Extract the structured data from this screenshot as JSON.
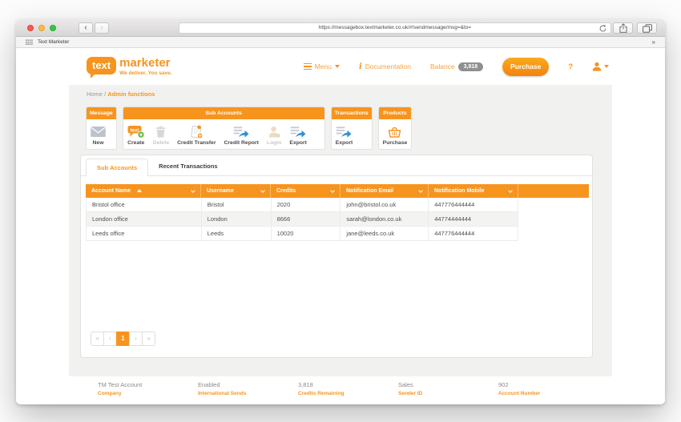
{
  "browser": {
    "url": "https://messagebox.textmarketer.co.uk/#!sendmessage/msg=&to=",
    "nav": {
      "back": "‹",
      "forward": "›"
    },
    "bookmarks": {
      "label": "Text Marketer",
      "overflow": "»"
    }
  },
  "header": {
    "logo": {
      "bubble_text": "text",
      "name": "marketer",
      "tagline": "We deliver. You save."
    },
    "nav": {
      "menu_label": "Menu",
      "documentation_label": "Documentation",
      "balance_label": "Balance",
      "balance_value": "3,818",
      "purchase_label": "Purchase",
      "help_label": "?"
    }
  },
  "breadcrumb": {
    "home": "Home",
    "separator": "/",
    "current": "Admin functions"
  },
  "toolbar": {
    "groups": [
      {
        "title": "Message",
        "items": [
          {
            "label": "New",
            "icon": "envelope-icon",
            "disabled": false
          }
        ]
      },
      {
        "title": "Sub Accounts",
        "items": [
          {
            "label": "Create",
            "icon": "speech-bubble-plus-icon",
            "disabled": false
          },
          {
            "label": "Delete",
            "icon": "trash-icon",
            "disabled": true
          },
          {
            "label": "Credit Transfer",
            "icon": "document-transfer-icon",
            "disabled": false
          },
          {
            "label": "Credit Report",
            "icon": "document-export-icon",
            "disabled": false
          },
          {
            "label": "Login",
            "icon": "person-icon",
            "disabled": true
          },
          {
            "label": "Export",
            "icon": "document-export-icon",
            "disabled": false
          }
        ]
      },
      {
        "title": "Transactions",
        "items": [
          {
            "label": "Export",
            "icon": "document-export-icon",
            "disabled": false
          }
        ]
      },
      {
        "title": "Products",
        "items": [
          {
            "label": "Purchase",
            "icon": "basket-icon",
            "disabled": false
          }
        ]
      }
    ]
  },
  "tabs": [
    {
      "label": "Sub Accounts",
      "active": true
    },
    {
      "label": "Recent Transactions",
      "active": false
    }
  ],
  "table": {
    "columns": [
      {
        "label": "Account Name",
        "sorted": "asc"
      },
      {
        "label": "Username"
      },
      {
        "label": "Credits"
      },
      {
        "label": "Notification Email"
      },
      {
        "label": "Notification Mobile"
      }
    ],
    "rows": [
      [
        "Bristol office",
        "Bristol",
        "2020",
        "john@bristol.co.uk",
        "447776444444"
      ],
      [
        "London office",
        "London",
        "8666",
        "sarah@london.co.uk",
        "44774444444"
      ],
      [
        "Leeds office",
        "Leeds",
        "10020",
        "jane@leeds.co.uk",
        "447776444444"
      ]
    ]
  },
  "pagination": {
    "first": "«",
    "prev": "‹",
    "current": "1",
    "next": "›",
    "last": "»"
  },
  "footer": {
    "stats": [
      {
        "value": "TM Test Account",
        "label": "Company"
      },
      {
        "value": "Enabled",
        "label": "International Sends"
      },
      {
        "value": "3,818",
        "label": "Credits Remaining"
      },
      {
        "value": "Sales",
        "label": "Sender ID"
      },
      {
        "value": "902",
        "label": "Account Number"
      }
    ]
  },
  "colors": {
    "brand_orange": "#f7941e",
    "nav_orange": "#f6a23e",
    "badge_gray": "#8f8f8f",
    "content_bg": "#f1f1ef",
    "table_header_bg": "#f7941e",
    "row_stripe": "#f3f3f2"
  }
}
